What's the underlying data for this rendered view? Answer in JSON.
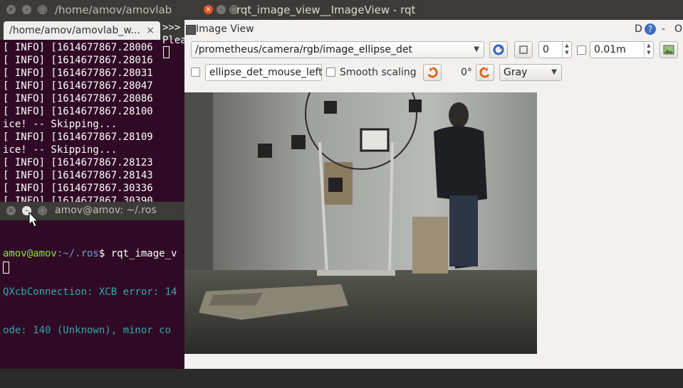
{
  "terminal1": {
    "title": "/home/amov/amovlab",
    "tab_label": "/home/amov/amovlab_w...",
    "tab_close": "×",
    "partial_right": ">>>",
    "partial_right2": "Plea",
    "log_lines": [
      "[ INFO] [1614677867.28006",
      "[ INFO] [1614677867.28016",
      "[ INFO] [1614677867.28031",
      "[ INFO] [1614677867.28047",
      "[ INFO] [1614677867.28086",
      "[ INFO] [1614677867.28100",
      "ice! -- Skipping...",
      "[ INFO] [1614677867.28109",
      "ice! -- Skipping...",
      "[ INFO] [1614677867.28123",
      "[ INFO] [1614677867.28143",
      "[ INFO] [1614677867.30336",
      "[ INFO] [1614677867.30390"
    ]
  },
  "terminal2": {
    "title": "amov@amov: ~/.ros",
    "prompt_user": "amov@amov",
    "prompt_path": ":~/.ros",
    "prompt_cmd": "$ rqt_image_v",
    "error1": "QXcbConnection: XCB error: 14",
    "error2": "ode: 140 (Unknown), minor co"
  },
  "rqt": {
    "title": "rqt_image_view__ImageView - rqt",
    "plugin_title": "Image View",
    "corner_d": "D",
    "corner_help": "?",
    "corner_dash": "-",
    "corner_o": "O",
    "topic": "/prometheus/camera/rgb/image_ellipse_det",
    "spin_value": "0",
    "max_depth": "0.01m",
    "mouse_topic": "ellipse_det_mouse_left",
    "smooth_label": "Smooth scaling",
    "rotation": "0°",
    "color_scheme": "Gray"
  }
}
